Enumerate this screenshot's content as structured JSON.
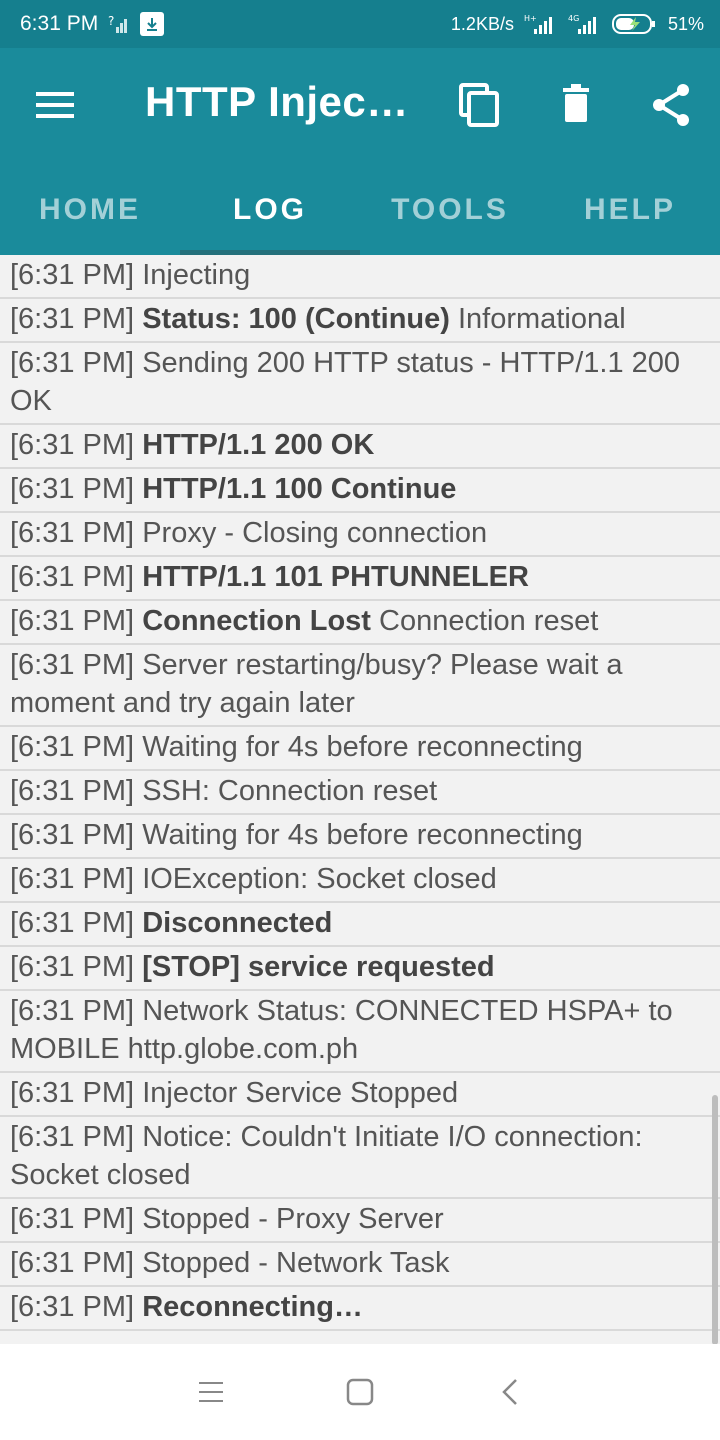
{
  "status_bar": {
    "time": "6:31 PM",
    "speed": "1.2KB/s",
    "battery": "51%"
  },
  "app_bar": {
    "title": "HTTP Injec…",
    "icons": [
      "menu-icon",
      "copy-icon",
      "trash-icon",
      "share-icon"
    ]
  },
  "tabs": [
    {
      "label": "HOME",
      "active": false
    },
    {
      "label": "LOG",
      "active": true
    },
    {
      "label": "TOOLS",
      "active": false
    },
    {
      "label": "HELP",
      "active": false
    }
  ],
  "log": [
    {
      "time": "[6:31 PM]",
      "bold": "",
      "text": "Injecting"
    },
    {
      "time": "[6:31 PM]",
      "bold": "Status: 100 (Continue)",
      "text": "Informational"
    },
    {
      "time": "[6:31 PM]",
      "bold": "",
      "text": "Sending 200 HTTP status - HTTP/1.1 200 OK"
    },
    {
      "time": "[6:31 PM]",
      "bold": "HTTP/1.1 200 OK",
      "text": ""
    },
    {
      "time": "[6:31 PM]",
      "bold": "HTTP/1.1 100 Continue",
      "text": ""
    },
    {
      "time": "[6:31 PM]",
      "bold": "",
      "text": "Proxy - Closing connection"
    },
    {
      "time": "[6:31 PM]",
      "bold": "HTTP/1.1 101 PHTUNNELER",
      "text": ""
    },
    {
      "time": "[6:31 PM]",
      "bold": "Connection Lost",
      "text": "Connection reset"
    },
    {
      "time": "[6:31 PM]",
      "bold": "",
      "text": "Server restarting/busy? Please wait a moment and try again later"
    },
    {
      "time": "[6:31 PM]",
      "bold": "",
      "text": "Waiting for 4s before reconnecting"
    },
    {
      "time": "[6:31 PM]",
      "bold": "",
      "text": "SSH: Connection reset"
    },
    {
      "time": "[6:31 PM]",
      "bold": "",
      "text": "Waiting for 4s before reconnecting"
    },
    {
      "time": "[6:31 PM]",
      "bold": "",
      "text": "IOException: Socket closed"
    },
    {
      "time": "[6:31 PM]",
      "bold": "Disconnected",
      "text": ""
    },
    {
      "time": "[6:31 PM]",
      "bold": "[STOP] service requested",
      "text": ""
    },
    {
      "time": "[6:31 PM]",
      "bold": "",
      "text": "Network Status: CONNECTED HSPA+ to MOBILE http.globe.com.ph"
    },
    {
      "time": "[6:31 PM]",
      "bold": "",
      "text": "Injector Service Stopped"
    },
    {
      "time": "[6:31 PM]",
      "bold": "",
      "text": "Notice: Couldn't Initiate I/O connection: Socket closed"
    },
    {
      "time": "[6:31 PM]",
      "bold": "",
      "text": "Stopped - Proxy Server"
    },
    {
      "time": "[6:31 PM]",
      "bold": "",
      "text": "Stopped - Network Task"
    },
    {
      "time": "[6:31 PM]",
      "bold": "Reconnecting…",
      "text": ""
    }
  ],
  "nav_bar": {
    "icons": [
      "recents-icon",
      "home-icon",
      "back-icon"
    ]
  }
}
